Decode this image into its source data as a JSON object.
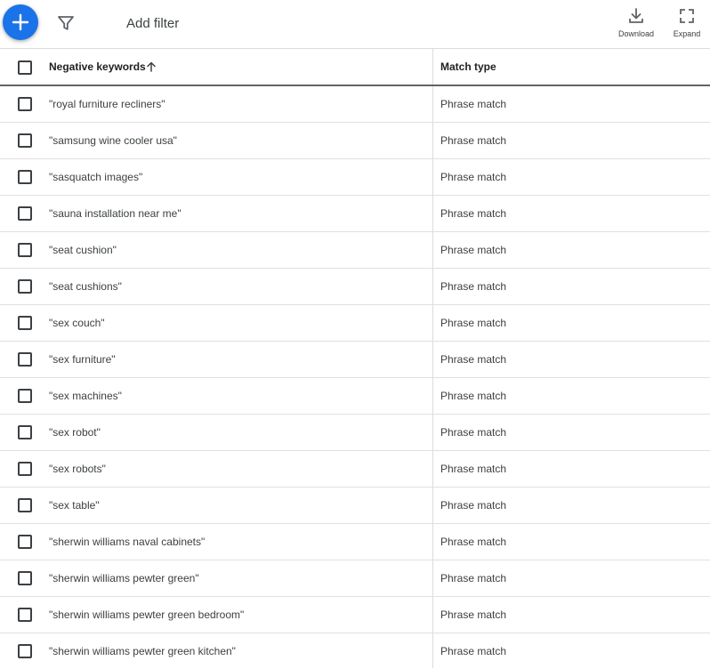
{
  "toolbar": {
    "add_filter_label": "Add filter",
    "download_label": "Download",
    "expand_label": "Expand",
    "accent_color": "#1a73e8"
  },
  "table": {
    "columns": [
      "Negative keywords",
      "Match type"
    ],
    "sort_indicator": "arrow-up-icon",
    "rows": [
      {
        "keyword": "\"royal furniture recliners\"",
        "match": "Phrase match"
      },
      {
        "keyword": "\"samsung wine cooler usa\"",
        "match": "Phrase match"
      },
      {
        "keyword": "\"sasquatch images\"",
        "match": "Phrase match"
      },
      {
        "keyword": "\"sauna installation near me\"",
        "match": "Phrase match"
      },
      {
        "keyword": "\"seat cushion\"",
        "match": "Phrase match"
      },
      {
        "keyword": "\"seat cushions\"",
        "match": "Phrase match"
      },
      {
        "keyword": "\"sex couch\"",
        "match": "Phrase match"
      },
      {
        "keyword": "\"sex furniture\"",
        "match": "Phrase match"
      },
      {
        "keyword": "\"sex machines\"",
        "match": "Phrase match"
      },
      {
        "keyword": "\"sex robot\"",
        "match": "Phrase match"
      },
      {
        "keyword": "\"sex robots\"",
        "match": "Phrase match"
      },
      {
        "keyword": "\"sex table\"",
        "match": "Phrase match"
      },
      {
        "keyword": "\"sherwin williams naval cabinets\"",
        "match": "Phrase match"
      },
      {
        "keyword": "\"sherwin williams pewter green\"",
        "match": "Phrase match"
      },
      {
        "keyword": "\"sherwin williams pewter green bedroom\"",
        "match": "Phrase match"
      },
      {
        "keyword": "\"sherwin williams pewter green kitchen\"",
        "match": "Phrase match"
      }
    ]
  }
}
